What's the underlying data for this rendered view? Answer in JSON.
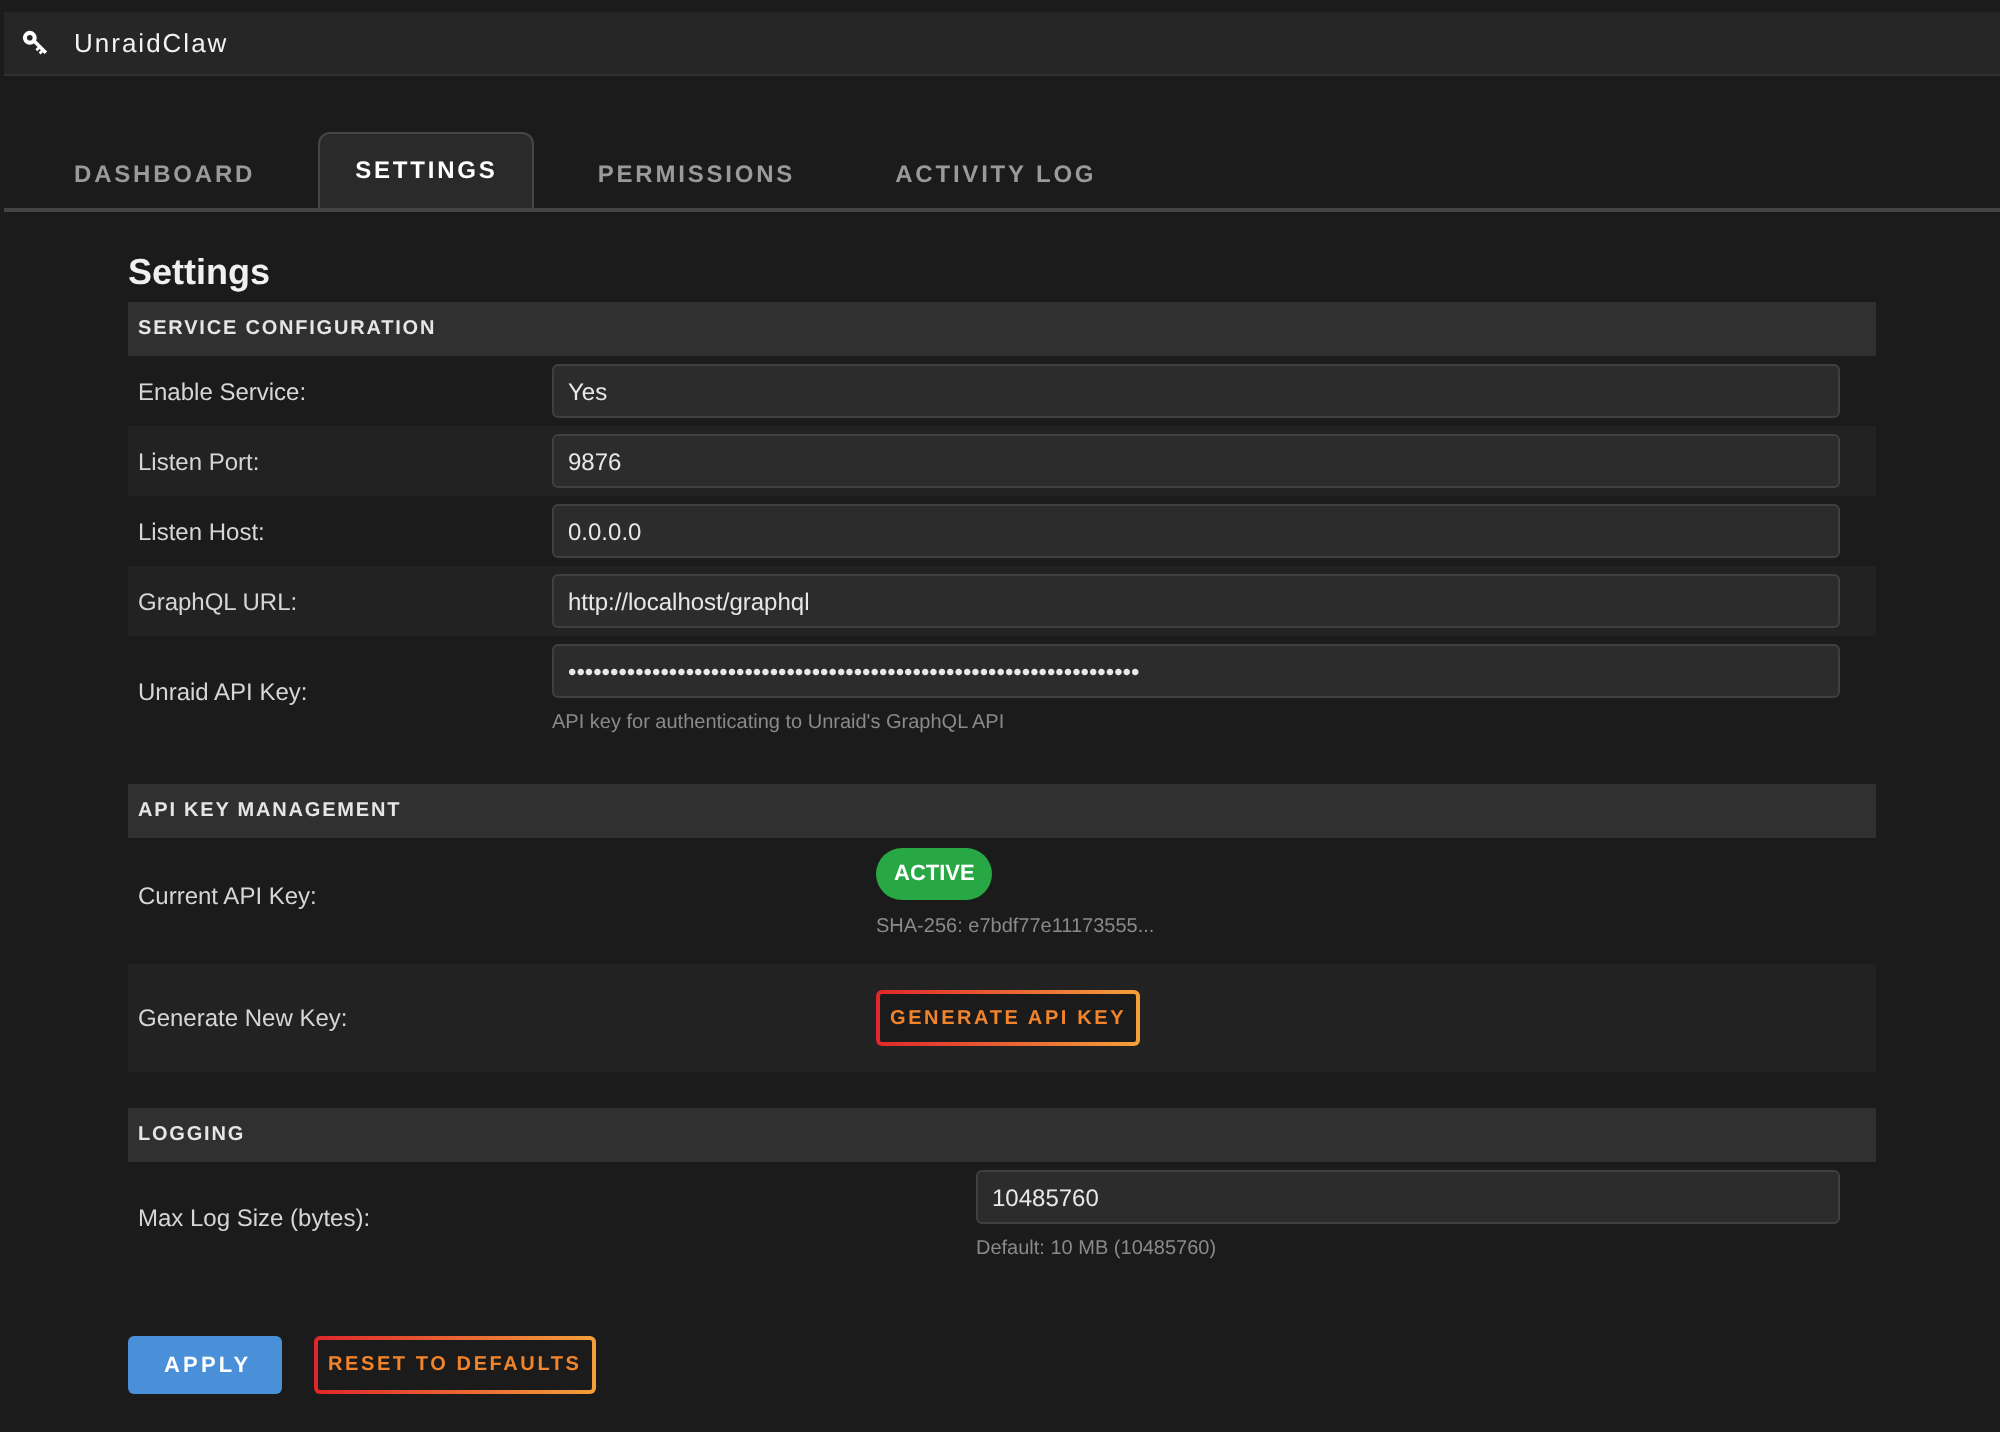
{
  "app": {
    "title": "UnraidClaw"
  },
  "tabs": [
    {
      "label": "DASHBOARD",
      "selected": false
    },
    {
      "label": "SETTINGS",
      "selected": true
    },
    {
      "label": "PERMISSIONS",
      "selected": false
    },
    {
      "label": "ACTIVITY LOG",
      "selected": false
    }
  ],
  "page": {
    "heading": "Settings"
  },
  "sections": [
    {
      "title": "SERVICE CONFIGURATION",
      "rows": [
        {
          "kind": "input",
          "label": "Enable Service:",
          "value": "Yes"
        },
        {
          "kind": "input",
          "label": "Listen Port:",
          "value": "9876"
        },
        {
          "kind": "input",
          "label": "Listen Host:",
          "value": "0.0.0.0"
        },
        {
          "kind": "input",
          "label": "GraphQL URL:",
          "value": "http://localhost/graphql"
        },
        {
          "kind": "input",
          "label": "Unraid API Key:",
          "value": "••••••••••••••••••••••••••••••••••••••••••••••••••••••••••••••••••••",
          "help": "API key for authenticating to Unraid's GraphQL API"
        }
      ]
    },
    {
      "title": "API KEY MANAGEMENT",
      "rows": [
        {
          "kind": "status",
          "label": "Current API Key:",
          "badge": "ACTIVE",
          "help": "SHA-256: e7bdf77e11173555..."
        },
        {
          "kind": "button",
          "label": "Generate New Key:",
          "button": "GENERATE API KEY"
        }
      ]
    },
    {
      "title": "LOGGING",
      "rows": [
        {
          "kind": "input",
          "label": "Max Log Size (bytes):",
          "value": "10485760",
          "help": "Default: 10 MB (10485760)"
        }
      ]
    }
  ],
  "actions": [
    {
      "kind": "primary",
      "label": "APPLY"
    },
    {
      "kind": "outline",
      "label": "RESET TO DEFAULTS"
    }
  ]
}
